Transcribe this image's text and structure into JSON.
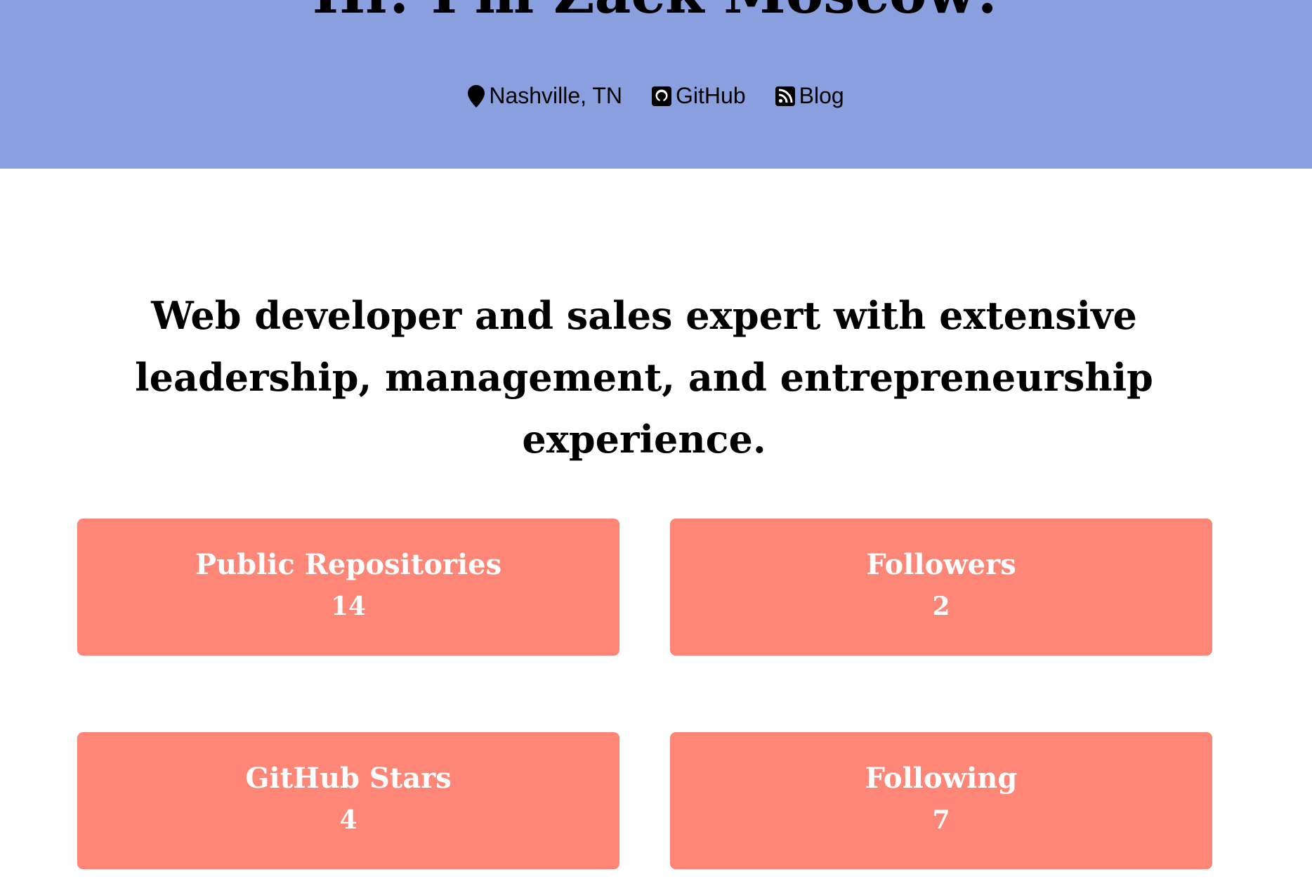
{
  "hero": {
    "title": "Hi! I'm Zack Moscow!",
    "background_color": "#8a9fdd",
    "links": [
      {
        "icon": "map-pin-icon",
        "label": "Nashville, TN"
      },
      {
        "icon": "github-icon",
        "label": "GitHub"
      },
      {
        "icon": "rss-icon",
        "label": "Blog"
      }
    ]
  },
  "tagline": "Web developer and sales expert with extensive leadership, management, and entrepreneurship experience.",
  "stats": {
    "card_color": "#fe8677",
    "repos": {
      "label": "Public Repositories",
      "value": "14"
    },
    "followers": {
      "label": "Followers",
      "value": "2"
    },
    "stars": {
      "label": "GitHub Stars",
      "value": "4"
    },
    "following": {
      "label": "Following",
      "value": "7"
    }
  }
}
